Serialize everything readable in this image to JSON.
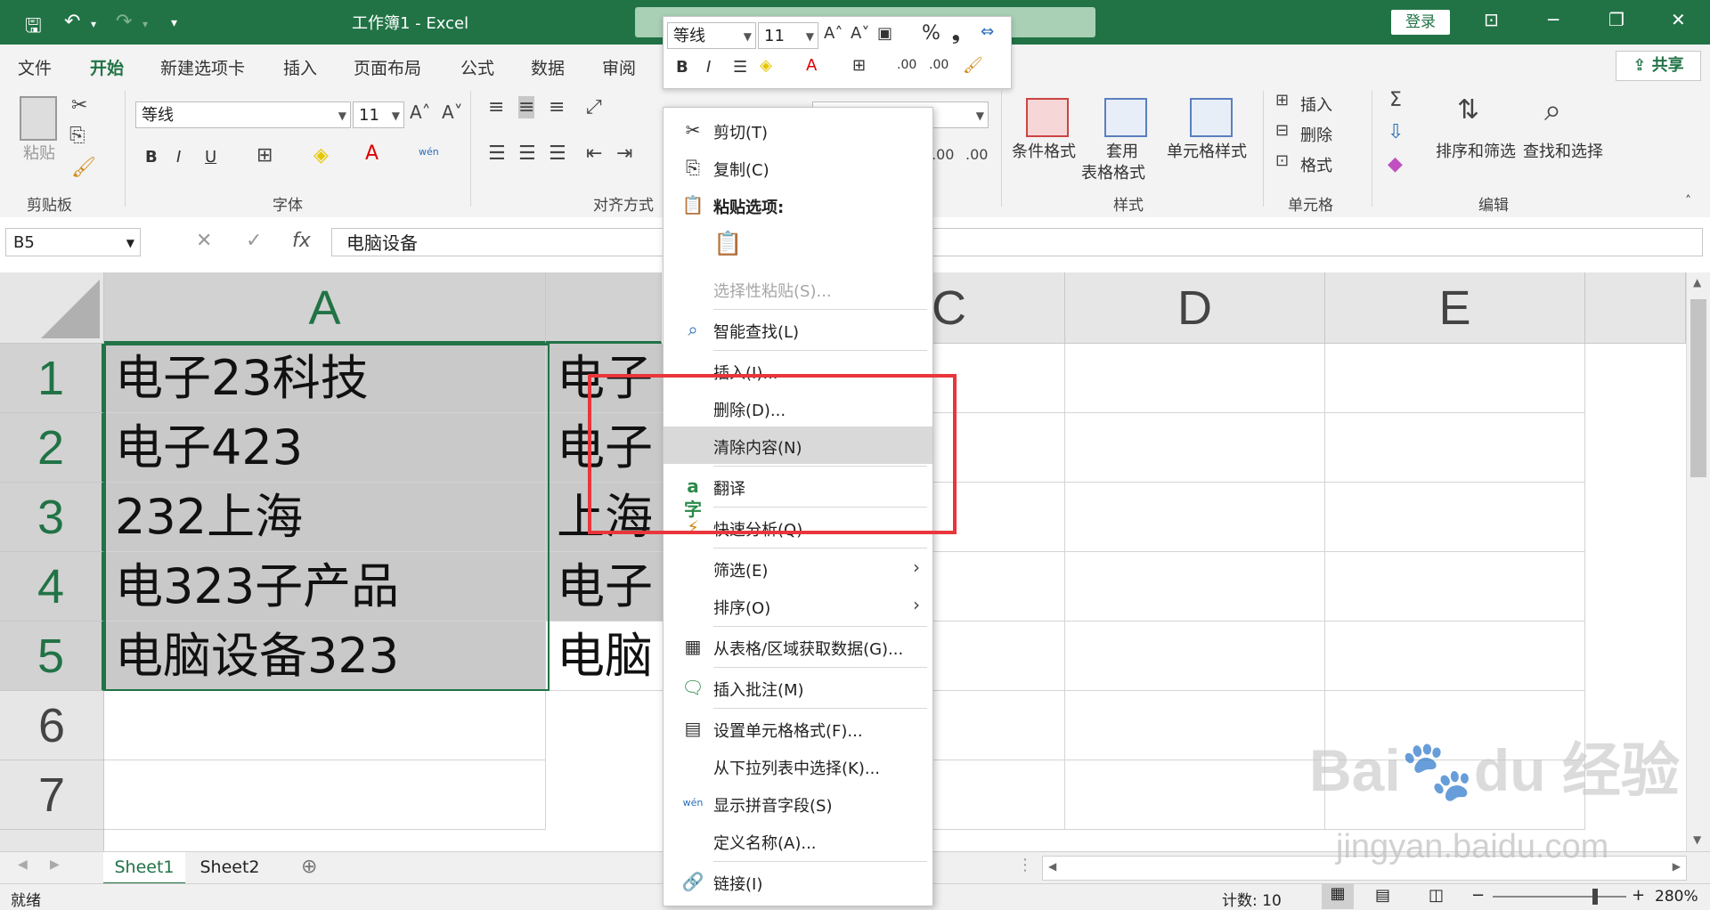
{
  "window": {
    "title": "工作簿1  -  Excel",
    "login_label": "登录"
  },
  "ribbon_tabs": [
    "文件",
    "开始",
    "新建选项卡",
    "插入",
    "页面布局",
    "公式",
    "数据",
    "审阅"
  ],
  "share_label": "共享",
  "ribbon": {
    "clipboard": {
      "group": "剪贴板",
      "paste": "粘贴"
    },
    "font": {
      "group": "字体",
      "name": "等线",
      "size": "11",
      "bold": "B",
      "italic": "I",
      "underline": "U",
      "pinyin": "wén"
    },
    "alignment": {
      "group": "对齐方式"
    },
    "styles": {
      "group": "样式",
      "conditional": "条件格式",
      "table_a": "套用",
      "table_b": "表格格式",
      "cell_styles": "单元格样式"
    },
    "cells": {
      "group": "单元格",
      "insert": "插入",
      "delete": "删除",
      "format": "格式"
    },
    "editing": {
      "group": "编辑",
      "sort": "排序和筛选",
      "find": "查找和选择"
    }
  },
  "formula_bar": {
    "name_box": "B5",
    "value": "电脑设备"
  },
  "columns": [
    "A",
    "C",
    "D",
    "E"
  ],
  "rows": [
    "1",
    "2",
    "3",
    "4",
    "5",
    "6",
    "7"
  ],
  "cells": {
    "A": [
      "电子23科技",
      "电子423",
      "232上海",
      "电323子产品",
      "电脑设备323"
    ],
    "B": [
      "电子",
      "电子",
      "上海",
      "电子",
      "电脑"
    ]
  },
  "sheets": [
    "Sheet1",
    "Sheet2"
  ],
  "status": {
    "ready": "就绪",
    "count": "计数: 10",
    "zoom": "280%"
  },
  "mini_toolbar": {
    "font": "等线",
    "size": "11",
    "percent": "%",
    "bold": "B",
    "italic": "I"
  },
  "context_menu": {
    "cut": "剪切(T)",
    "copy": "复制(C)",
    "paste_options": "粘贴选项:",
    "paste_special": "选择性粘贴(S)...",
    "smart_lookup": "智能查找(L)",
    "insert": "插入(I)...",
    "delete": "删除(D)...",
    "clear": "清除内容(N)",
    "translate": "翻译",
    "quick_analysis": "快速分析(Q)",
    "filter": "筛选(E)",
    "sort": "排序(O)",
    "get_data": "从表格/区域获取数据(G)...",
    "insert_comment": "插入批注(M)",
    "format_cells": "设置单元格格式(F)...",
    "pick_list": "从下拉列表中选择(K)...",
    "phonetic": "显示拼音字段(S)",
    "define_name": "定义名称(A)...",
    "link": "链接(I)"
  },
  "colors": {
    "excel_green": "#217346",
    "highlight_red": "#e9363b"
  }
}
